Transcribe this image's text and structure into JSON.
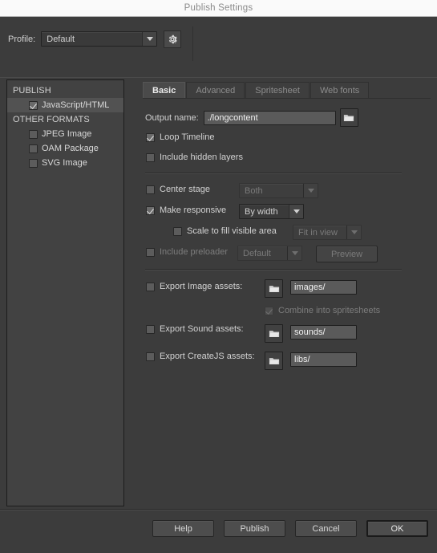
{
  "window": {
    "title": "Publish Settings"
  },
  "profile": {
    "label": "Profile:",
    "value": "Default",
    "gear_icon": "gear-icon",
    "arrow_icon": "chevron-down-icon"
  },
  "sidebar": {
    "groups": [
      {
        "title": "PUBLISH",
        "items": [
          {
            "label": "JavaScript/HTML",
            "checked": true,
            "selected": true
          }
        ]
      },
      {
        "title": "OTHER FORMATS",
        "items": [
          {
            "label": "JPEG Image",
            "checked": false,
            "selected": false
          },
          {
            "label": "OAM Package",
            "checked": false,
            "selected": false
          },
          {
            "label": "SVG Image",
            "checked": false,
            "selected": false
          }
        ]
      }
    ]
  },
  "tabs": [
    {
      "label": "Basic",
      "active": true
    },
    {
      "label": "Advanced",
      "active": false
    },
    {
      "label": "Spritesheet",
      "active": false
    },
    {
      "label": "Web fonts",
      "active": false
    }
  ],
  "basic": {
    "output_name_label": "Output name:",
    "output_name_value": "./longcontent",
    "browse_icon": "folder-icon",
    "loop_timeline": {
      "label": "Loop Timeline",
      "checked": true
    },
    "include_hidden_layers": {
      "label": "Include hidden layers",
      "checked": false
    },
    "center_stage": {
      "label": "Center stage",
      "checked": false,
      "select_value": "Both",
      "enabled": false
    },
    "make_responsive": {
      "label": "Make responsive",
      "checked": true,
      "select_value": "By width",
      "enabled": true
    },
    "scale_to_fill": {
      "label": "Scale to fill visible area",
      "checked": false,
      "select_value": "Fit in view",
      "enabled": false
    },
    "include_preloader": {
      "label": "Include preloader",
      "checked": false,
      "select_value": "Default",
      "enabled": false,
      "preview_label": "Preview"
    },
    "export_image_assets": {
      "label": "Export Image assets:",
      "checked": false,
      "path": "images/",
      "folder_icon": "folder-icon"
    },
    "combine_spritesheets": {
      "label": "Combine into spritesheets",
      "checked": true,
      "enabled": false
    },
    "export_sound_assets": {
      "label": "Export Sound assets:",
      "checked": false,
      "path": "sounds/",
      "folder_icon": "folder-icon"
    },
    "export_createjs_assets": {
      "label": "Export CreateJS assets:",
      "checked": false,
      "path": "libs/",
      "folder_icon": "folder-icon"
    }
  },
  "footer": {
    "help": "Help",
    "publish": "Publish",
    "cancel": "Cancel",
    "ok": "OK"
  },
  "colors": {
    "window_bg": "#3c3c3c",
    "panel_bg": "#424242",
    "titlebar_bg": "#fafafa",
    "text": "#d2d2d2",
    "text_dim": "#7d7d7d",
    "selection": "#525252"
  }
}
